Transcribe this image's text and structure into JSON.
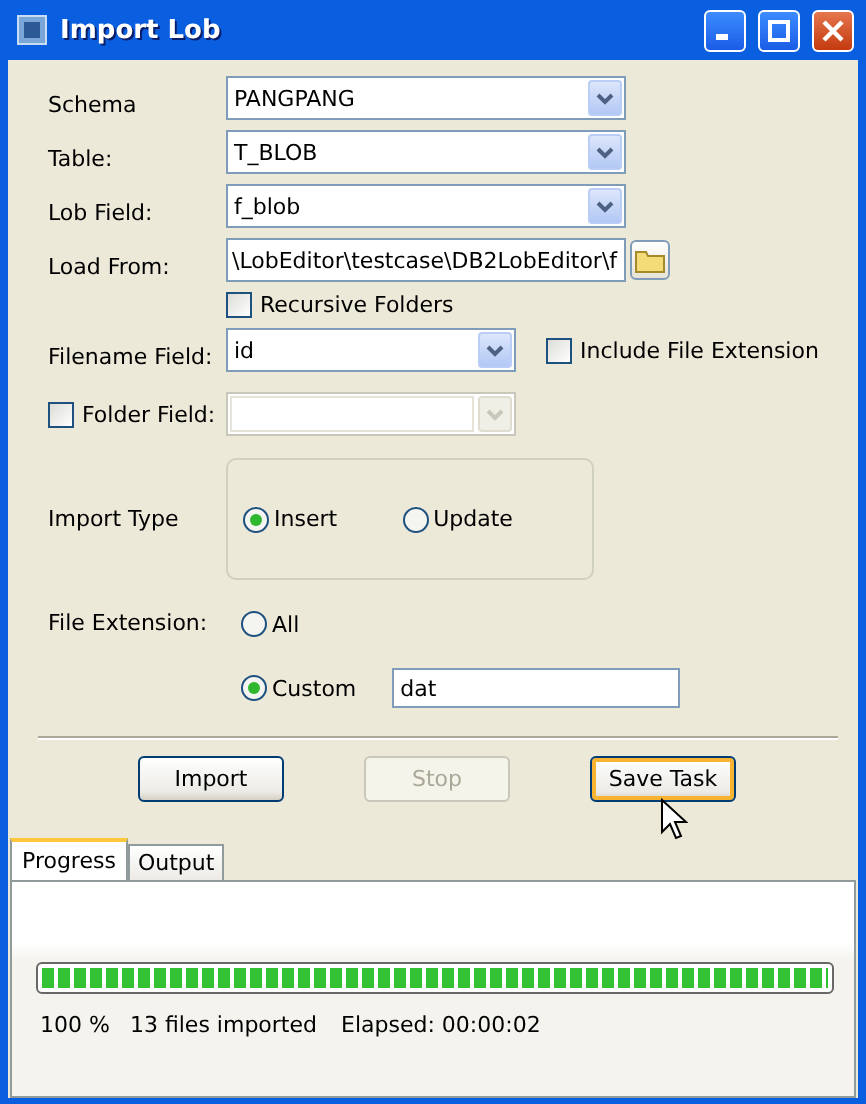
{
  "window": {
    "title": "Import Lob"
  },
  "combos": [
    {
      "label": "Schema",
      "value": "PANGPANG"
    },
    {
      "label": "Table:",
      "value": "T_BLOB"
    },
    {
      "label": "Lob Field:",
      "value": "f_blob"
    }
  ],
  "load_from": {
    "label": "Load From:",
    "value": "\\LobEditor\\testcase\\DB2LobEditor\\f"
  },
  "recursive_folders": {
    "label": "Recursive Folders",
    "checked": false
  },
  "filename_field": {
    "label": "Filename Field:",
    "value": "id",
    "disabled": false
  },
  "include_extension": {
    "label": "Include File Extension",
    "checked": false
  },
  "folder_field": {
    "label": "Folder Field:",
    "checked": false,
    "disabled": true
  },
  "import_type": {
    "label": "Import Type",
    "options": [
      {
        "label": "Insert",
        "selected": true
      },
      {
        "label": "Update",
        "selected": false
      }
    ]
  },
  "file_extension": {
    "label": "File Extension:",
    "options": [
      {
        "label": "All",
        "selected": false
      },
      {
        "label": "Custom",
        "selected": true
      }
    ],
    "custom_value": "dat"
  },
  "buttons": [
    {
      "label": "Import",
      "disabled": false,
      "hovered": false
    },
    {
      "label": "Stop",
      "disabled": true,
      "hovered": false
    },
    {
      "label": "Save Task",
      "disabled": false,
      "hovered": true
    }
  ],
  "tabs": [
    {
      "label": "Progress",
      "selected": true
    },
    {
      "label": "Output",
      "selected": false
    }
  ],
  "progress": {
    "level": 1,
    "percent": "100 %",
    "files": "13 files imported",
    "elapsed": "Elapsed: 00:00:02"
  }
}
